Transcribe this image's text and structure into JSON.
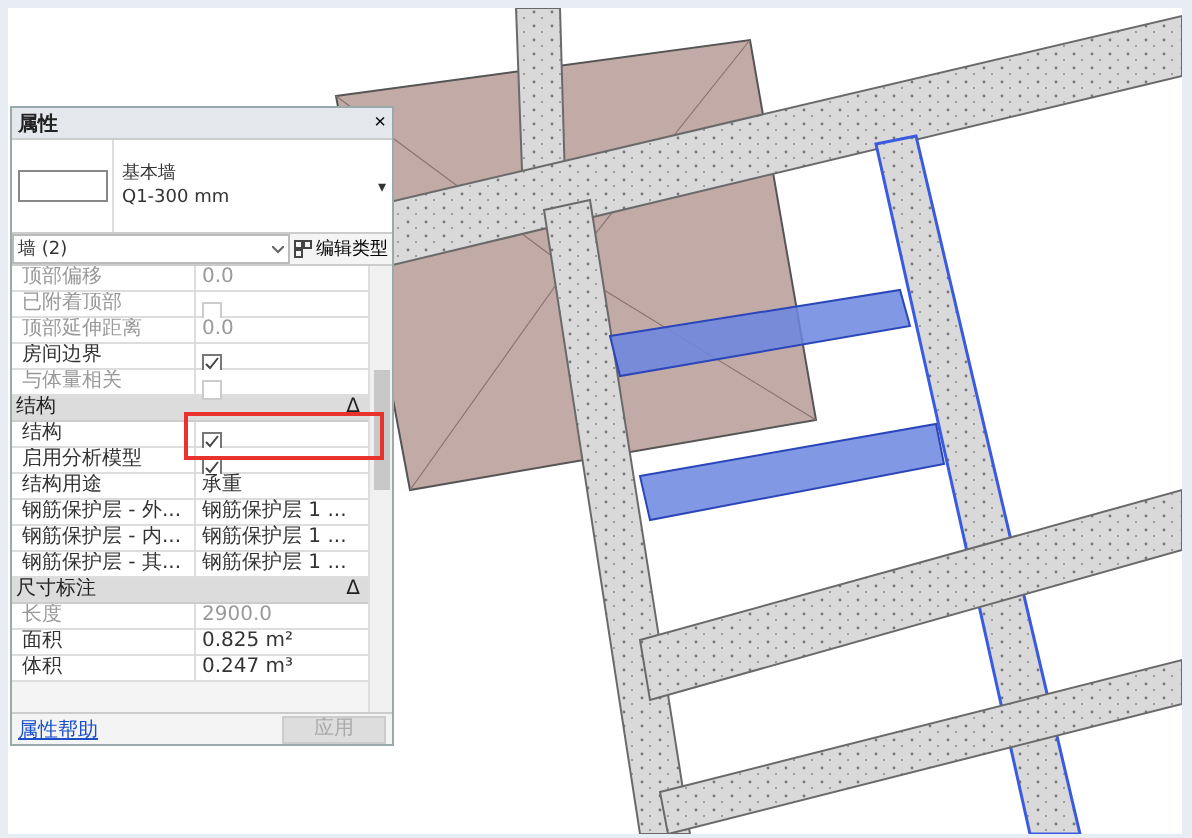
{
  "properties_panel": {
    "title": "属性",
    "close_label": "×",
    "type_family": "基本墙",
    "type_name": "Q1-300 mm",
    "dropdown_caret": "▾",
    "instance_selector": {
      "value": "墙 (2)",
      "edit_type_label": "编辑类型"
    },
    "rows": [
      {
        "kind": "text",
        "label": "顶部偏移",
        "value": "0.0",
        "disabled": true
      },
      {
        "kind": "checkbox",
        "label": "已附着顶部",
        "checked": false,
        "disabled": true
      },
      {
        "kind": "text",
        "label": "顶部延伸距离",
        "value": "0.0",
        "disabled": true
      },
      {
        "kind": "checkbox",
        "label": "房间边界",
        "checked": true,
        "disabled": false
      },
      {
        "kind": "checkbox",
        "label": "与体量相关",
        "checked": false,
        "disabled": true
      },
      {
        "kind": "header",
        "label": "结构",
        "collapse_mark": "ᐃ"
      },
      {
        "kind": "checkbox",
        "label": "结构",
        "checked": true,
        "disabled": false,
        "highlighted": true
      },
      {
        "kind": "checkbox",
        "label": "启用分析模型",
        "checked": true,
        "disabled": false
      },
      {
        "kind": "text",
        "label": "结构用途",
        "value": "承重",
        "disabled": false
      },
      {
        "kind": "text",
        "label": "钢筋保护层 - 外...",
        "value": "钢筋保护层 1 ...",
        "disabled": false
      },
      {
        "kind": "text",
        "label": "钢筋保护层 - 内...",
        "value": "钢筋保护层 1 ...",
        "disabled": false
      },
      {
        "kind": "text",
        "label": "钢筋保护层 - 其...",
        "value": "钢筋保护层 1 ...",
        "disabled": false
      },
      {
        "kind": "header",
        "label": "尺寸标注",
        "collapse_mark": "ᐃ"
      },
      {
        "kind": "text",
        "label": "长度",
        "value": "2900.0",
        "disabled": true
      },
      {
        "kind": "text",
        "label": "面积",
        "value": "0.825 m²",
        "disabled": false
      },
      {
        "kind": "text",
        "label": "体积",
        "value": "0.247 m³",
        "disabled": false
      }
    ],
    "help_link": "属性帮助",
    "apply_button": {
      "label": "应用",
      "disabled": true
    }
  }
}
